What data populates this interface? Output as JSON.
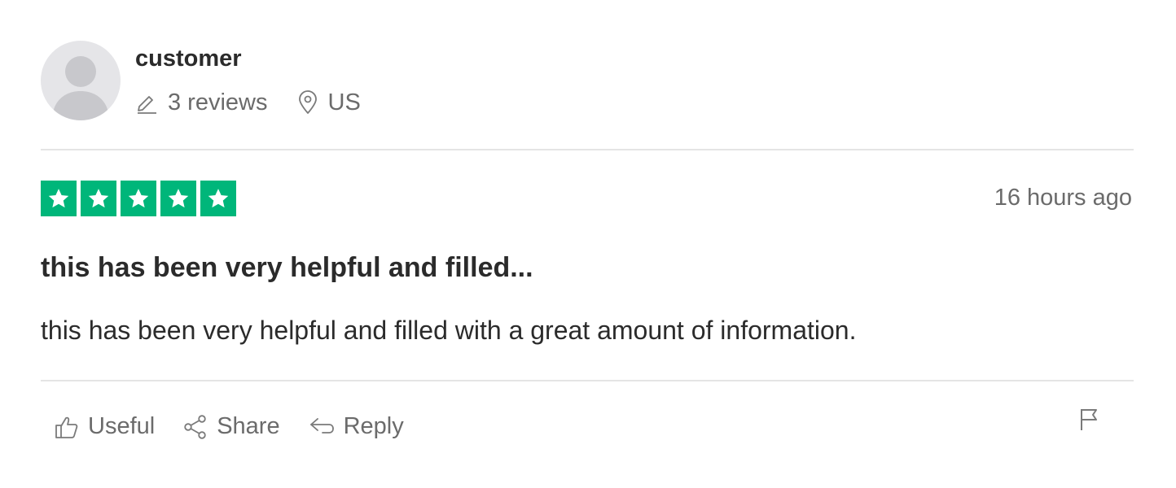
{
  "reviewer": {
    "name": "customer",
    "review_count": "3 reviews",
    "country": "US",
    "avatar_icon": "default-person-avatar"
  },
  "review": {
    "rating": 5,
    "max_rating": 5,
    "date": "16 hours ago",
    "title": "this has been very helpful and filled...",
    "body": "this has been very helpful and filled with a great amount of information."
  },
  "actions": {
    "useful_label": "Useful",
    "share_label": "Share",
    "reply_label": "Reply",
    "flag_icon": "flag-icon"
  },
  "colors": {
    "star_fill": "#00b67a",
    "muted_text": "#6b6b6b",
    "divider": "#e4e4e4"
  }
}
